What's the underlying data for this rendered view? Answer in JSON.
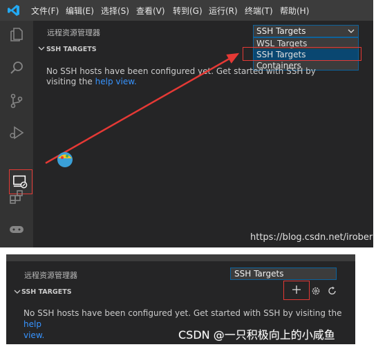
{
  "top_panel": {
    "menu": [
      "文件(F)",
      "编辑(E)",
      "选择(S)",
      "查看(V)",
      "转到(G)",
      "运行(R)",
      "终端(T)",
      "帮助(H)"
    ],
    "explorer_title": "远程资源管理器",
    "targets_select": {
      "value": "SSH Targets",
      "options": [
        "WSL Targets",
        "SSH Targets",
        "Containers"
      ],
      "highlighted": "SSH Targets"
    },
    "section_header": "SSH TARGETS",
    "message": "No SSH hosts have been configured yet. Get started with SSH by visiting the",
    "message_link": "help",
    "message_link_tail": "view.",
    "watermark": "https://blog.csdn.net/irober",
    "activity_icons": [
      "files-icon",
      "search-icon",
      "source-control-icon",
      "run-debug-icon",
      "remote-explorer-icon",
      "extensions-icon",
      "gamepad-icon"
    ]
  },
  "bottom_panel": {
    "explorer_title": "远程资源管理器",
    "targets_select": {
      "value": "SSH Targets"
    },
    "section_header": "SSH TARGETS",
    "message": "No SSH hosts have been configured yet. Get started with SSH by visiting the",
    "message_link": "help",
    "message_link_tail": "view.",
    "actions": [
      "add-icon",
      "gear-icon",
      "refresh-icon"
    ]
  },
  "caption": "CSDN @一只积极向上的小咸鱼",
  "colors": {
    "accent": "#0e639c",
    "highlight_red": "#e53935",
    "selected_option": "#094771",
    "link": "#3794ff"
  }
}
